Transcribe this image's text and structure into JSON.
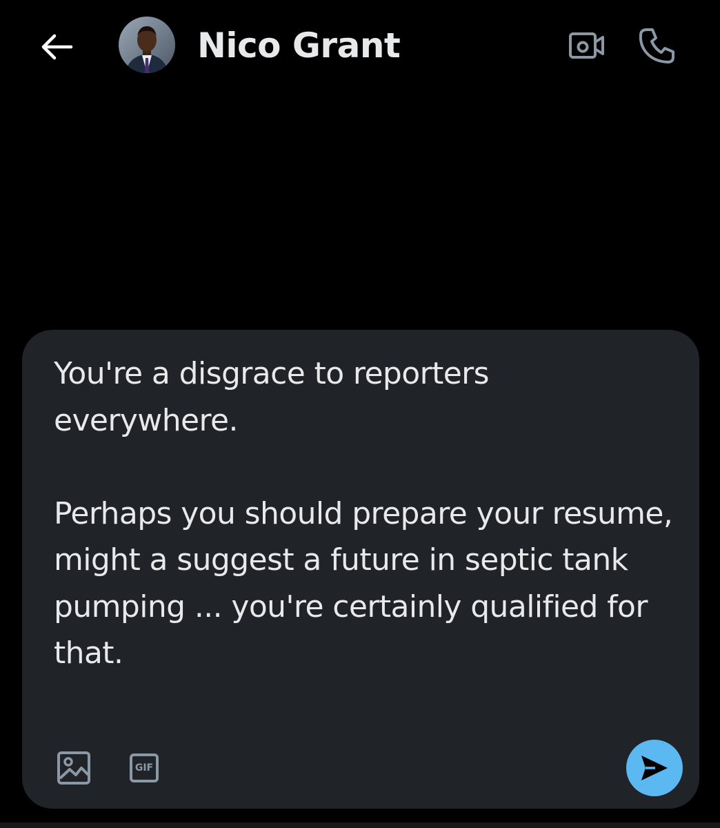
{
  "header": {
    "contact_name": "Nico Grant",
    "back_icon": "arrow-left-icon",
    "video_icon": "video-call-icon",
    "call_icon": "phone-icon"
  },
  "composer": {
    "text": "You're a disgrace to reporters everywhere.\n\nPerhaps you should prepare your resume, might a suggest a future in septic tank pumping ... you're certainly qualified for that.",
    "gif_label": "GIF",
    "media_icon": "image-icon",
    "send_icon": "send-icon"
  },
  "colors": {
    "background": "#000000",
    "composer_bg": "#202327",
    "text": "#e7e9ea",
    "icon_gray": "#8b98a5",
    "accent": "#5cb8f0"
  }
}
